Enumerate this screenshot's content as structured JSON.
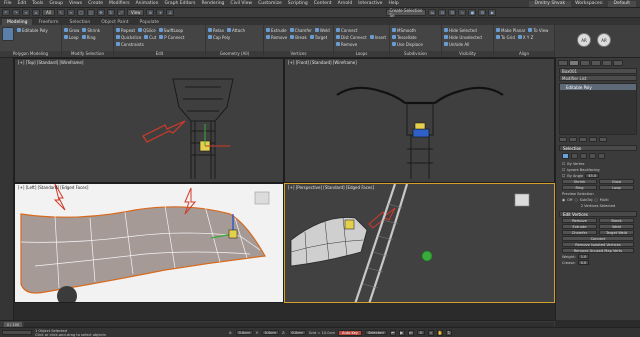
{
  "menu": {
    "items": [
      "File",
      "Edit",
      "Tools",
      "Group",
      "Views",
      "Create",
      "Modifiers",
      "Animation",
      "Graph Editors",
      "Rendering",
      "Civil View",
      "Customize",
      "Scripting",
      "Content",
      "Arnold",
      "Interactive",
      "Help"
    ],
    "user": "Dmitry Shvak",
    "workspace_label": "Workspaces:",
    "workspace_value": "Default"
  },
  "toolbar": {
    "filter": "All",
    "view": "View",
    "selection_set": "Create Selection Se"
  },
  "ribbon": {
    "tabs": [
      "Modeling",
      "Freeform",
      "Selection",
      "Object Paint",
      "Populate"
    ],
    "active_tab": 0,
    "groups": [
      {
        "label": "Polygon Modeling",
        "items": [
          "Editable Poly"
        ]
      },
      {
        "label": "Modify Selection",
        "items": [
          "Grow",
          "Shrink",
          "Loop",
          "Ring"
        ]
      },
      {
        "label": "Edit",
        "items": [
          "Repeat",
          "QSlice",
          "SwiftLoop",
          "Quickslice",
          "Cut",
          "P Connect",
          "Constraints"
        ]
      },
      {
        "label": "Geometry (All)",
        "items": [
          "Relax",
          "Attach",
          "Cap Poly"
        ]
      },
      {
        "label": "Vertices",
        "items": [
          "Extrude",
          "Chamfer",
          "Weld",
          "Remove",
          "Break",
          "Target"
        ]
      },
      {
        "label": "Loops",
        "items": [
          "Connect",
          "Dist Connect",
          "Insert",
          "Remove"
        ]
      },
      {
        "label": "Subdivision",
        "items": [
          "MSmooth",
          "Tessellate",
          "Use Displace"
        ]
      },
      {
        "label": "Visibility",
        "items": [
          "Hide Selected",
          "Hide Unselected",
          "Unhide All"
        ]
      },
      {
        "label": "Align",
        "items": [
          "Make Planar",
          "To View",
          "To Grid",
          "X Y Z"
        ]
      }
    ],
    "mode_badges": [
      "AR",
      "AR"
    ]
  },
  "viewports": {
    "top_left": "[+] [Top] [Standard] [Wireframe]",
    "top_right": "[+] [Front] [Standard] [Wireframe]",
    "bottom_left": "[+] [Left] [Standard] [Edged Faces]",
    "bottom_right": "[+] [Perspective] [Standard] [Edged Faces]"
  },
  "command_panel": {
    "object_name": "Box001",
    "modifier_list_label": "Modifier List",
    "stack_item": "Editable Poly",
    "selection_rollout": "Selection",
    "by_vertex": "By Vertex",
    "ignore_backfacing": "Ignore Backfacing",
    "by_angle": "By Angle",
    "by_angle_value": "45.0",
    "shrink": "Shrink",
    "grow": "Grow",
    "ring": "Ring",
    "loop": "Loop",
    "preview_selection": "Preview Selection",
    "preview_off": "Off",
    "preview_subobj": "SubObj",
    "preview_multi": "Multi",
    "selected_info": "2 Vertices Selected",
    "edit_vertices_rollout": "Edit Vertices",
    "remove": "Remove",
    "break": "Break",
    "extrude": "Extrude",
    "weld": "Weld",
    "chamfer": "Chamfer",
    "target_weld": "Target Weld",
    "connect": "Connect",
    "remove_isolated": "Remove Isolated Vertices",
    "remove_unused": "Remove Unused Map Verts",
    "weight_label": "Weight:",
    "weight_value": "1.0",
    "crease_label": "Crease:",
    "crease_value": "0.0"
  },
  "timeline": {
    "frame": "0 / 100"
  },
  "status": {
    "selected": "1 Object Selected",
    "prompt": "Click or click-and-drag to select objects",
    "x_label": "X:",
    "x_value": "0.0cm",
    "y_label": "Y:",
    "y_value": "0.0cm",
    "z_label": "Z:",
    "z_value": "0.0cm",
    "grid": "Grid = 10.0cm",
    "auto_key": "Auto Key",
    "set_key": "Set Key",
    "selected_drop": "Selected",
    "key_filters": "Key Filters...",
    "frame_value": "0"
  },
  "colors": {
    "accent": "#d4a22c",
    "selection_blue": "#6aa0dc",
    "autokey_red": "#b94a3d",
    "arrow_red": "#d23a2a"
  }
}
